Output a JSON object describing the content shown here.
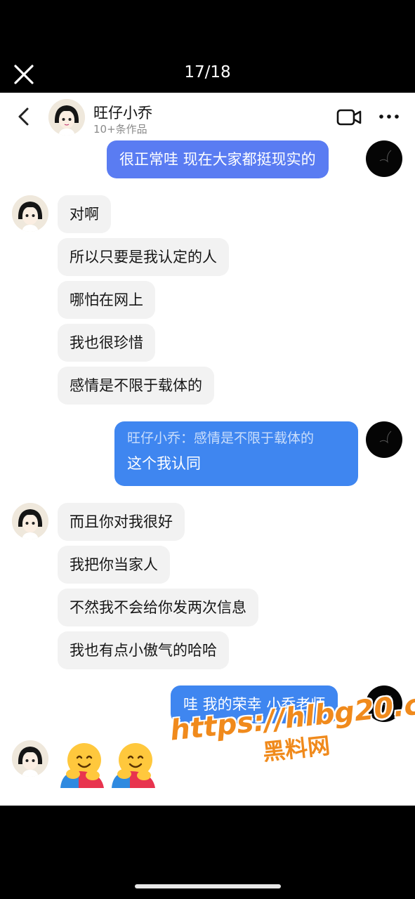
{
  "viewer": {
    "counter": "17/18",
    "close_icon": "close-icon"
  },
  "header": {
    "contact_name": "旺仔小乔",
    "subtitle": "10+条作品",
    "icons": [
      "back-icon",
      "video-call-icon",
      "more-icon"
    ]
  },
  "messages": [
    {
      "side": "out",
      "text": "很正常哇 现在大家都挺现实的"
    },
    {
      "side": "in",
      "text": "对啊"
    },
    {
      "side": "in",
      "text": "所以只要是我认定的人"
    },
    {
      "side": "in",
      "text": "哪怕在网上"
    },
    {
      "side": "in",
      "text": "我也很珍惜"
    },
    {
      "side": "in",
      "text": "感情是不限于载体的"
    },
    {
      "side": "out",
      "quote": "旺仔小乔：感情是不限于载体的",
      "text": "这个我认同"
    },
    {
      "side": "in",
      "text": "而且你对我很好"
    },
    {
      "side": "in",
      "text": "我把你当家人"
    },
    {
      "side": "in",
      "text": "不然我不会给你发两次信息"
    },
    {
      "side": "in",
      "text": "我也有点小傲气的哈哈"
    },
    {
      "side": "out",
      "text": "哇 我的荣幸 小乔老师"
    },
    {
      "side": "in",
      "emoji": [
        "hugging-face-emoji",
        "hugging-face-emoji"
      ]
    }
  ],
  "watermark": {
    "url": "https://hlbg20.com",
    "label": "黑料网"
  },
  "colors": {
    "outgoing_bubble": "#5a7cf2",
    "outgoing_bubble_alt": "#3f86f0",
    "incoming_bubble": "#f2f2f2",
    "watermark": "#f08a1c"
  }
}
